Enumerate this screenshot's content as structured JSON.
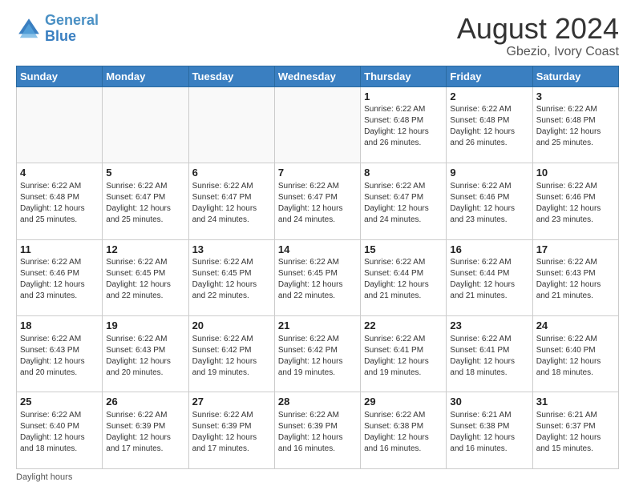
{
  "header": {
    "logo_line1": "General",
    "logo_line2": "Blue",
    "main_title": "August 2024",
    "subtitle": "Gbezio, Ivory Coast"
  },
  "days_of_week": [
    "Sunday",
    "Monday",
    "Tuesday",
    "Wednesday",
    "Thursday",
    "Friday",
    "Saturday"
  ],
  "weeks": [
    [
      {
        "day": "",
        "info": ""
      },
      {
        "day": "",
        "info": ""
      },
      {
        "day": "",
        "info": ""
      },
      {
        "day": "",
        "info": ""
      },
      {
        "day": "1",
        "info": "Sunrise: 6:22 AM\nSunset: 6:48 PM\nDaylight: 12 hours\nand 26 minutes."
      },
      {
        "day": "2",
        "info": "Sunrise: 6:22 AM\nSunset: 6:48 PM\nDaylight: 12 hours\nand 26 minutes."
      },
      {
        "day": "3",
        "info": "Sunrise: 6:22 AM\nSunset: 6:48 PM\nDaylight: 12 hours\nand 25 minutes."
      }
    ],
    [
      {
        "day": "4",
        "info": "Sunrise: 6:22 AM\nSunset: 6:48 PM\nDaylight: 12 hours\nand 25 minutes."
      },
      {
        "day": "5",
        "info": "Sunrise: 6:22 AM\nSunset: 6:47 PM\nDaylight: 12 hours\nand 25 minutes."
      },
      {
        "day": "6",
        "info": "Sunrise: 6:22 AM\nSunset: 6:47 PM\nDaylight: 12 hours\nand 24 minutes."
      },
      {
        "day": "7",
        "info": "Sunrise: 6:22 AM\nSunset: 6:47 PM\nDaylight: 12 hours\nand 24 minutes."
      },
      {
        "day": "8",
        "info": "Sunrise: 6:22 AM\nSunset: 6:47 PM\nDaylight: 12 hours\nand 24 minutes."
      },
      {
        "day": "9",
        "info": "Sunrise: 6:22 AM\nSunset: 6:46 PM\nDaylight: 12 hours\nand 23 minutes."
      },
      {
        "day": "10",
        "info": "Sunrise: 6:22 AM\nSunset: 6:46 PM\nDaylight: 12 hours\nand 23 minutes."
      }
    ],
    [
      {
        "day": "11",
        "info": "Sunrise: 6:22 AM\nSunset: 6:46 PM\nDaylight: 12 hours\nand 23 minutes."
      },
      {
        "day": "12",
        "info": "Sunrise: 6:22 AM\nSunset: 6:45 PM\nDaylight: 12 hours\nand 22 minutes."
      },
      {
        "day": "13",
        "info": "Sunrise: 6:22 AM\nSunset: 6:45 PM\nDaylight: 12 hours\nand 22 minutes."
      },
      {
        "day": "14",
        "info": "Sunrise: 6:22 AM\nSunset: 6:45 PM\nDaylight: 12 hours\nand 22 minutes."
      },
      {
        "day": "15",
        "info": "Sunrise: 6:22 AM\nSunset: 6:44 PM\nDaylight: 12 hours\nand 21 minutes."
      },
      {
        "day": "16",
        "info": "Sunrise: 6:22 AM\nSunset: 6:44 PM\nDaylight: 12 hours\nand 21 minutes."
      },
      {
        "day": "17",
        "info": "Sunrise: 6:22 AM\nSunset: 6:43 PM\nDaylight: 12 hours\nand 21 minutes."
      }
    ],
    [
      {
        "day": "18",
        "info": "Sunrise: 6:22 AM\nSunset: 6:43 PM\nDaylight: 12 hours\nand 20 minutes."
      },
      {
        "day": "19",
        "info": "Sunrise: 6:22 AM\nSunset: 6:43 PM\nDaylight: 12 hours\nand 20 minutes."
      },
      {
        "day": "20",
        "info": "Sunrise: 6:22 AM\nSunset: 6:42 PM\nDaylight: 12 hours\nand 19 minutes."
      },
      {
        "day": "21",
        "info": "Sunrise: 6:22 AM\nSunset: 6:42 PM\nDaylight: 12 hours\nand 19 minutes."
      },
      {
        "day": "22",
        "info": "Sunrise: 6:22 AM\nSunset: 6:41 PM\nDaylight: 12 hours\nand 19 minutes."
      },
      {
        "day": "23",
        "info": "Sunrise: 6:22 AM\nSunset: 6:41 PM\nDaylight: 12 hours\nand 18 minutes."
      },
      {
        "day": "24",
        "info": "Sunrise: 6:22 AM\nSunset: 6:40 PM\nDaylight: 12 hours\nand 18 minutes."
      }
    ],
    [
      {
        "day": "25",
        "info": "Sunrise: 6:22 AM\nSunset: 6:40 PM\nDaylight: 12 hours\nand 18 minutes."
      },
      {
        "day": "26",
        "info": "Sunrise: 6:22 AM\nSunset: 6:39 PM\nDaylight: 12 hours\nand 17 minutes."
      },
      {
        "day": "27",
        "info": "Sunrise: 6:22 AM\nSunset: 6:39 PM\nDaylight: 12 hours\nand 17 minutes."
      },
      {
        "day": "28",
        "info": "Sunrise: 6:22 AM\nSunset: 6:39 PM\nDaylight: 12 hours\nand 16 minutes."
      },
      {
        "day": "29",
        "info": "Sunrise: 6:22 AM\nSunset: 6:38 PM\nDaylight: 12 hours\nand 16 minutes."
      },
      {
        "day": "30",
        "info": "Sunrise: 6:21 AM\nSunset: 6:38 PM\nDaylight: 12 hours\nand 16 minutes."
      },
      {
        "day": "31",
        "info": "Sunrise: 6:21 AM\nSunset: 6:37 PM\nDaylight: 12 hours\nand 15 minutes."
      }
    ]
  ],
  "footer": {
    "note": "Daylight hours"
  }
}
